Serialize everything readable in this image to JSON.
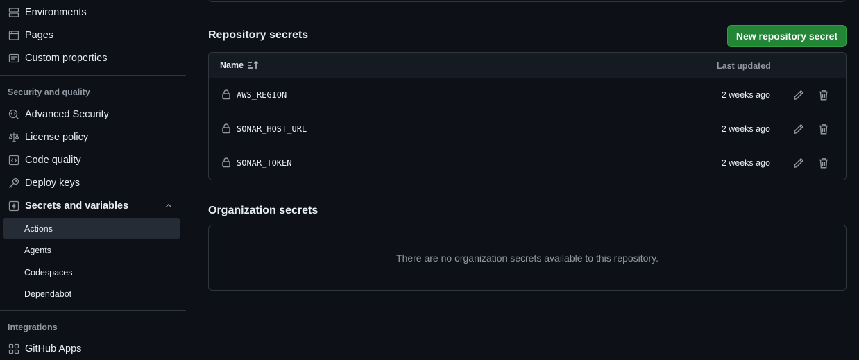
{
  "sidebar": {
    "items_top": [
      {
        "label": "Environments",
        "icon": "server-icon"
      },
      {
        "label": "Pages",
        "icon": "browser-icon"
      },
      {
        "label": "Custom properties",
        "icon": "note-icon"
      }
    ],
    "security_heading": "Security and quality",
    "security_items": [
      {
        "label": "Advanced Security",
        "icon": "codescan-icon"
      },
      {
        "label": "License policy",
        "icon": "law-icon"
      },
      {
        "label": "Code quality",
        "icon": "code-square-icon"
      },
      {
        "label": "Deploy keys",
        "icon": "key-icon"
      },
      {
        "label": "Secrets and variables",
        "icon": "asterisk-icon"
      }
    ],
    "secrets_subitems": [
      "Actions",
      "Agents",
      "Codespaces",
      "Dependabot"
    ],
    "active_subitem": "Actions",
    "integrations_heading": "Integrations",
    "integrations_items": [
      {
        "label": "GitHub Apps",
        "icon": "apps-icon"
      }
    ]
  },
  "repo_secrets": {
    "title": "Repository secrets",
    "new_button": "New repository secret",
    "col_name": "Name",
    "col_updated": "Last updated",
    "rows": [
      {
        "name": "AWS_REGION",
        "updated": "2 weeks ago"
      },
      {
        "name": "SONAR_HOST_URL",
        "updated": "2 weeks ago"
      },
      {
        "name": "SONAR_TOKEN",
        "updated": "2 weeks ago"
      }
    ]
  },
  "org_secrets": {
    "title": "Organization secrets",
    "empty_text": "There are no organization secrets available to this repository."
  },
  "colors": {
    "background": "#0d1117",
    "border": "#30363d",
    "primary_button": "#238636",
    "muted_text": "#9198a1",
    "active_nav": "#262c36"
  }
}
